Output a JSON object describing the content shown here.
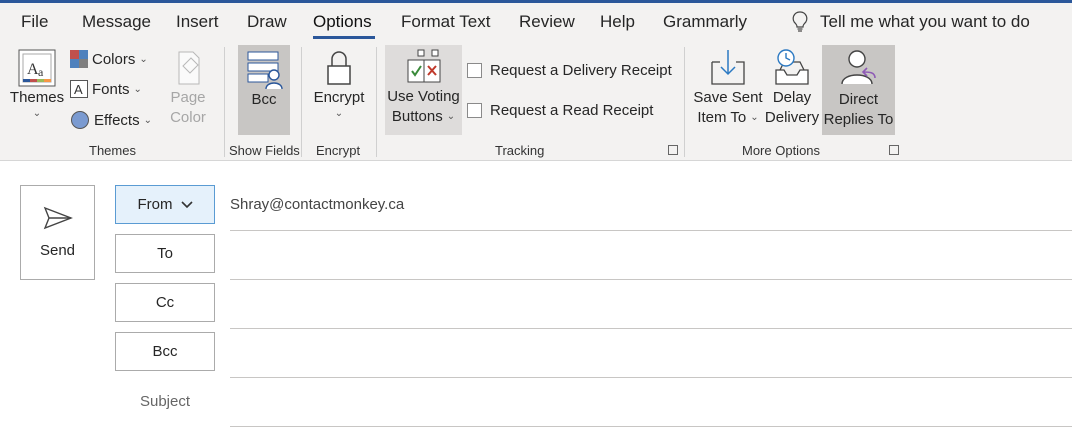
{
  "tabs": [
    "File",
    "Message",
    "Insert",
    "Draw",
    "Options",
    "Format Text",
    "Review",
    "Help",
    "Grammarly"
  ],
  "active_tab": "Options",
  "tell_me": "Tell me what you want to do",
  "ribbon": {
    "themes_group": {
      "themes": "Themes",
      "colors": "Colors",
      "fonts": "Fonts",
      "effects": "Effects",
      "page_color_1": "Page",
      "page_color_2": "Color",
      "label": "Themes"
    },
    "show_fields_group": {
      "bcc": "Bcc",
      "label": "Show Fields"
    },
    "encrypt_group": {
      "encrypt": "Encrypt",
      "label": "Encrypt"
    },
    "tracking_group": {
      "voting_1": "Use Voting",
      "voting_2": "Buttons",
      "delivery_receipt": "Request a Delivery Receipt",
      "read_receipt": "Request a Read Receipt",
      "label": "Tracking"
    },
    "more_options_group": {
      "save_sent_1": "Save Sent",
      "save_sent_2": "Item To",
      "delay_1": "Delay",
      "delay_2": "Delivery",
      "direct_1": "Direct",
      "direct_2": "Replies To",
      "label": "More Options"
    }
  },
  "compose": {
    "send": "Send",
    "from": "From",
    "from_value": "Shray@contactmonkey.ca",
    "to": "To",
    "cc": "Cc",
    "bcc": "Bcc",
    "subject": "Subject"
  },
  "colors": {
    "accent": "#2b579a",
    "ribbon_bg": "#f3f2f1",
    "pressed": "#c8c6c4"
  }
}
